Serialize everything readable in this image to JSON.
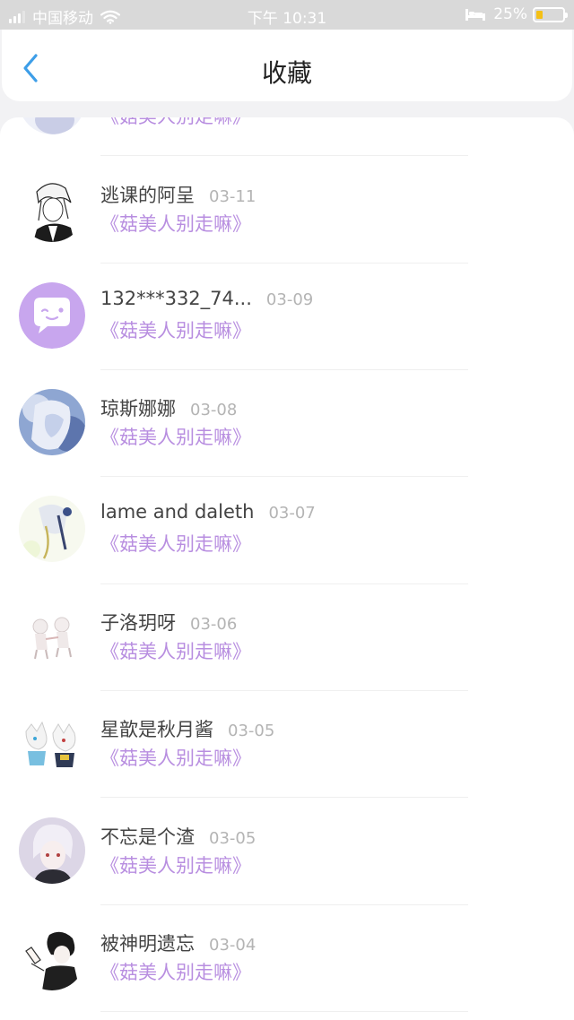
{
  "status_bar": {
    "carrier": "中国移动",
    "time": "下午 10:31",
    "battery_percent": "25%",
    "battery_level": 0.25,
    "battery_color": "#f4c016",
    "icons": [
      "signal-icon",
      "wifi-icon",
      "bed-icon",
      "battery-icon"
    ]
  },
  "header": {
    "back_icon": "chevron-left-icon",
    "title": "收藏"
  },
  "colors": {
    "accent": "#3d9ee8",
    "book_title": "#b88ee0",
    "date": "#b4b4b4"
  },
  "list": {
    "partial_top_book": "《菇美人别走嘛》",
    "items": [
      {
        "name": "逃课的阿呈",
        "date": "03-11",
        "book": "《菇美人别走嘛》",
        "avatar": "sketch-character-avatar"
      },
      {
        "name": "132***332_74...",
        "date": "03-09",
        "book": "《菇美人别走嘛》",
        "avatar": "default-chat-avatar"
      },
      {
        "name": "琼斯娜娜",
        "date": "03-08",
        "book": "《菇美人别走嘛》",
        "avatar": "illustration-avatar"
      },
      {
        "name": "lame and daleth",
        "date": "03-07",
        "book": "《菇美人别走嘛》",
        "avatar": "illustration-avatar"
      },
      {
        "name": "子洛玥呀",
        "date": "03-06",
        "book": "《菇美人别走嘛》",
        "avatar": "illustration-avatar"
      },
      {
        "name": "星歆是秋月酱",
        "date": "03-05",
        "book": "《菇美人别走嘛》",
        "avatar": "illustration-avatar"
      },
      {
        "name": "不忘是个渣",
        "date": "03-05",
        "book": "《菇美人别走嘛》",
        "avatar": "illustration-avatar"
      },
      {
        "name": "被神明遗忘",
        "date": "03-04",
        "book": "《菇美人别走嘛》",
        "avatar": "illustration-avatar"
      }
    ]
  }
}
